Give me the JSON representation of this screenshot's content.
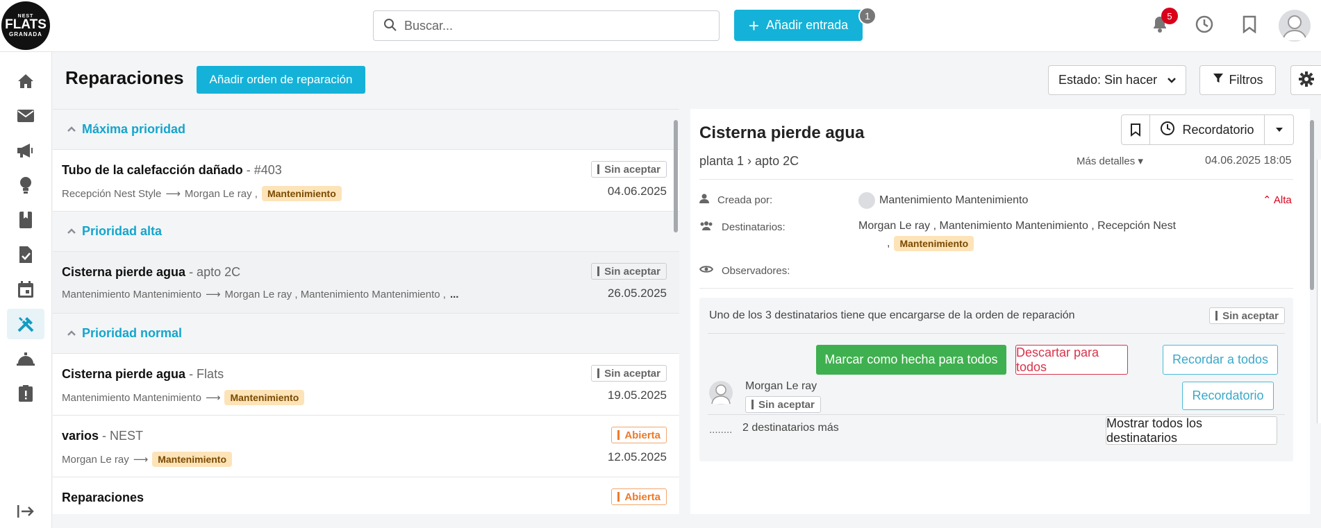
{
  "logo": {
    "line1": "NEST",
    "line2": "FLATS",
    "line3": "GRANADA"
  },
  "search": {
    "placeholder": "Buscar..."
  },
  "add_entry": {
    "label": "Añadir entrada",
    "count": "1"
  },
  "notifications": {
    "count": "5"
  },
  "header": {
    "title": "Reparaciones",
    "add_button": "Añadir orden de reparación",
    "estado": "Estado: Sin hacer",
    "filtros": "Filtros"
  },
  "groups": [
    {
      "label": "Máxima prioridad",
      "rows": [
        {
          "title": "Tubo de la calefacción dañado",
          "sub": " - #403",
          "from": "Recepción Nest Style",
          "to": "Morgan Le ray ,",
          "tag": "Mantenimiento",
          "status": "Sin aceptar",
          "date": "04.06.2025"
        }
      ]
    },
    {
      "label": "Prioridad alta",
      "rows": [
        {
          "title": "Cisterna pierde agua",
          "sub": " - apto 2C",
          "from": "Mantenimiento Mantenimiento",
          "to": "Morgan Le ray , Mantenimiento Mantenimiento ,",
          "extra": "...",
          "status": "Sin aceptar",
          "date": "26.05.2025"
        }
      ]
    },
    {
      "label": "Prioridad normal",
      "rows": [
        {
          "title": "Cisterna pierde agua",
          "sub": " -   Flats",
          "from": "Mantenimiento Mantenimiento",
          "tag": "Mantenimiento",
          "status": "Sin aceptar",
          "date": "19.05.2025"
        },
        {
          "title": "varios",
          "sub": " - NEST",
          "from": "Morgan Le ray",
          "tag": "Mantenimiento",
          "status": "Abierta",
          "date": "12.05.2025"
        },
        {
          "title": "Reparaciones",
          "status": "Abierta"
        }
      ]
    }
  ],
  "detail": {
    "title": "Cisterna pierde agua",
    "crumb": "planta 1 › apto 2C",
    "more": "Más detalles",
    "date": "04.06.2025 18:05",
    "recordatorio": "Recordatorio",
    "created_label": "Creada por:",
    "created_value": "Mantenimiento Mantenimiento",
    "priority": "Alta",
    "recipients_label": "Destinatarios:",
    "recipients_value": "Morgan Le ray , Mantenimiento Mantenimiento , Recepción Nest",
    "recipients_comma": ",",
    "recipients_tag": "Mantenimiento",
    "observers_label": "Observadores:",
    "box_msg": "Uno de los 3 destinatarios tiene que encargarse de la orden de reparación",
    "box_status": "Sin aceptar",
    "btn_done": "Marcar como hecha para todos",
    "btn_discard": "Descartar para todos",
    "btn_remind_all": "Recordar a todos",
    "recipient_name": "Morgan Le ray",
    "recipient_status": "Sin aceptar",
    "btn_remind": "Recordatorio",
    "more_dots": "........",
    "more_text": "2 destinatarios más",
    "btn_show_all": "Mostrar todos los destinatarios"
  }
}
